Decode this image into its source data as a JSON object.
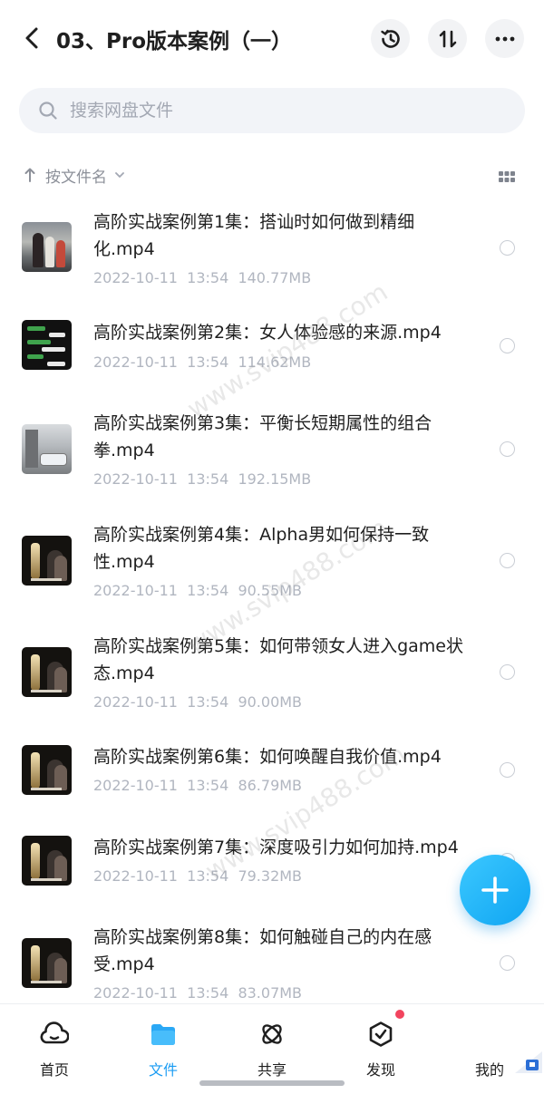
{
  "header": {
    "title": "03、Pro版本案例（一）",
    "icons": [
      "back-icon",
      "history-icon",
      "sort-icon",
      "more-icon"
    ]
  },
  "search": {
    "placeholder": "搜索网盘文件",
    "value": ""
  },
  "sort_bar": {
    "label": "按文件名",
    "icons": [
      "arrow-up-icon",
      "chevron-down-icon",
      "grid-view-icon"
    ]
  },
  "files": [
    {
      "name": "高阶实战案例第1集：搭讪时如何做到精细化.mp4",
      "date": "2022-10-11",
      "time": "13:54",
      "size": "140.77MB",
      "thumb": "street"
    },
    {
      "name": "高阶实战案例第2集：女人体验感的来源.mp4",
      "date": "2022-10-11",
      "time": "13:54",
      "size": "114.62MB",
      "thumb": "chat"
    },
    {
      "name": "高阶实战案例第3集：平衡长短期属性的组合拳.mp4",
      "date": "2022-10-11",
      "time": "13:54",
      "size": "192.15MB",
      "thumb": "city"
    },
    {
      "name": "高阶实战案例第4集：Alpha男如何保持一致性.mp4",
      "date": "2022-10-11",
      "time": "13:54",
      "size": "90.55MB",
      "thumb": "room"
    },
    {
      "name": "高阶实战案例第5集：如何带领女人进入game状态.mp4",
      "date": "2022-10-11",
      "time": "13:54",
      "size": "90.00MB",
      "thumb": "room"
    },
    {
      "name": "高阶实战案例第6集：如何唤醒自我价值.mp4",
      "date": "2022-10-11",
      "time": "13:54",
      "size": "86.79MB",
      "thumb": "room"
    },
    {
      "name": "高阶实战案例第7集：深度吸引力如何加持.mp4",
      "date": "2022-10-11",
      "time": "13:54",
      "size": "79.32MB",
      "thumb": "room"
    },
    {
      "name": "高阶实战案例第8集：如何触碰自己的内在感受.mp4",
      "date": "2022-10-11",
      "time": "13:54",
      "size": "83.07MB",
      "thumb": "room"
    }
  ],
  "fab": {
    "icon": "plus-icon",
    "color": "#1ab0f8"
  },
  "bottom_nav": {
    "items": [
      {
        "label": "首页",
        "icon": "home-icon"
      },
      {
        "label": "文件",
        "icon": "folder-icon",
        "active": true
      },
      {
        "label": "共享",
        "icon": "share-icon"
      },
      {
        "label": "发现",
        "icon": "discover-icon",
        "badge": true
      },
      {
        "label": "我的",
        "icon": "profile-icon"
      }
    ]
  },
  "watermark": "www.svip488.com",
  "colors": {
    "accent": "#1a9cf3",
    "badge": "#f2445e",
    "meta_text": "#b1b6c0"
  }
}
